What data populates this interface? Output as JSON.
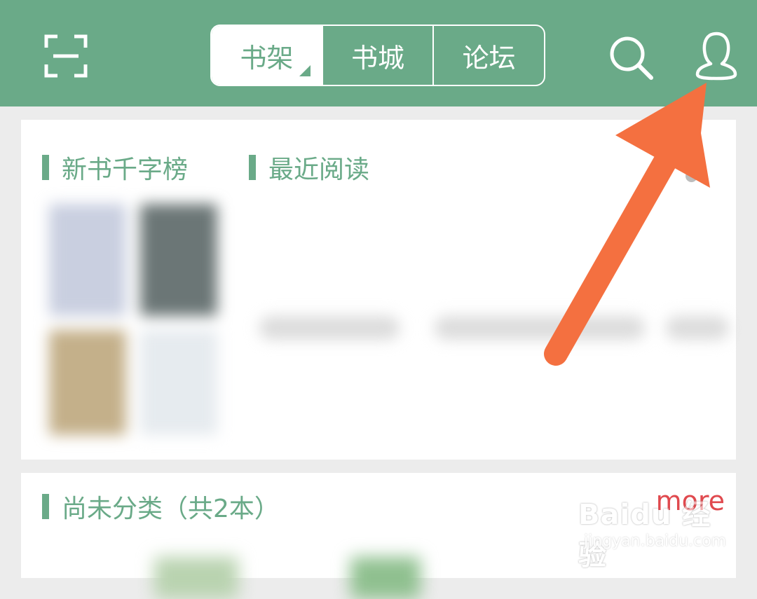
{
  "header": {
    "tabs": [
      {
        "label": "书架",
        "active": true
      },
      {
        "label": "书城",
        "active": false
      },
      {
        "label": "论坛",
        "active": false
      }
    ],
    "icons": [
      "scan-icon",
      "search-icon",
      "user-icon"
    ],
    "colors": {
      "theme": "#6aaa88",
      "arrow": "#f47040",
      "more": "#e0494e"
    }
  },
  "section1": {
    "tab1": "新书千字榜",
    "tab2": "最近阅读"
  },
  "section2": {
    "title": "尚未分类（共2本）",
    "more": "more"
  },
  "watermark": {
    "logo": "Baidu 经验",
    "url": "jingyan.baidu.com"
  }
}
